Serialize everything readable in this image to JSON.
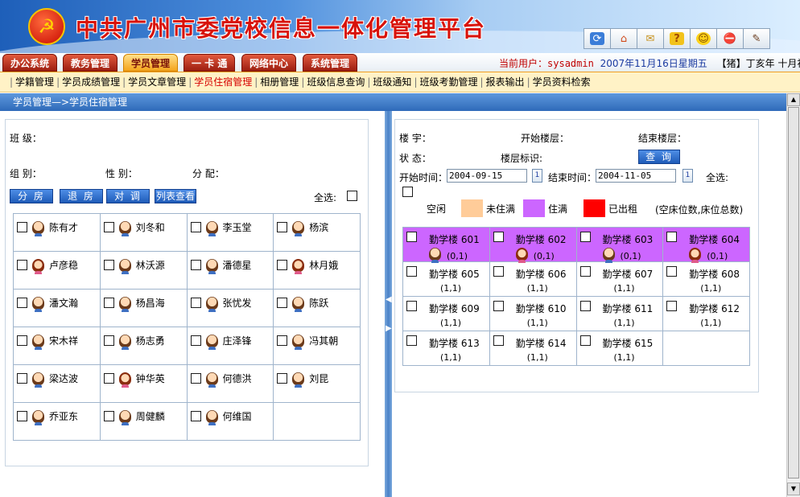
{
  "header": {
    "title": "中共广州市委党校信息一体化管理平台",
    "emblem_glyph": "☭",
    "toolbar_icons": [
      "refresh-icon",
      "home-icon",
      "mail-icon",
      "help-icon",
      "smiley-icon",
      "stop-icon",
      "user-settings-icon"
    ],
    "toolbar_glyphs": [
      "⟳",
      "⌂",
      "✉",
      "?",
      "☺",
      "⛔",
      "✎"
    ]
  },
  "nav": {
    "tabs": [
      "办公系统",
      "教务管理",
      "学员管理",
      "一 卡 通",
      "网络中心",
      "系统管理"
    ],
    "active_tab": "学员管理",
    "user_label": "当前用户：",
    "user": "sysadmin",
    "date": "2007年11月16日星期五",
    "lunar": "【猪】丁亥年 十月初七"
  },
  "subnav": {
    "items": [
      "学籍管理",
      "学员成绩管理",
      "学员文章管理",
      "学员住宿管理",
      "相册管理",
      "班级信息查询",
      "班级通知",
      "班级考勤管理",
      "报表输出",
      "学员资料检索"
    ],
    "active": "学员住宿管理"
  },
  "breadcrumb": "学员管理—>学员住宿管理",
  "left": {
    "class_label": "班 级：",
    "group_label": "组 别：",
    "gender_label": "性 别：",
    "assign_label": "分 配：",
    "buttons": [
      "分 房",
      "退 房",
      "对 调",
      "列表查看"
    ],
    "select_all_label": "全选:",
    "students": [
      {
        "name": "陈有才",
        "gender": "m"
      },
      {
        "name": "刘冬和",
        "gender": "m"
      },
      {
        "name": "李玉堂",
        "gender": "m"
      },
      {
        "name": "杨滨",
        "gender": "m"
      },
      {
        "name": "卢彦稳",
        "gender": "f"
      },
      {
        "name": "林沃源",
        "gender": "m"
      },
      {
        "name": "潘德星",
        "gender": "m"
      },
      {
        "name": "林月娥",
        "gender": "f"
      },
      {
        "name": "潘文瀚",
        "gender": "m"
      },
      {
        "name": "杨昌海",
        "gender": "m"
      },
      {
        "name": "张忧发",
        "gender": "m"
      },
      {
        "name": "陈跃",
        "gender": "m"
      },
      {
        "name": "宋木祥",
        "gender": "m"
      },
      {
        "name": "杨志勇",
        "gender": "m"
      },
      {
        "name": "庄泽锋",
        "gender": "m"
      },
      {
        "name": "冯其朝",
        "gender": "m"
      },
      {
        "name": "梁达波",
        "gender": "m"
      },
      {
        "name": "钟华英",
        "gender": "f"
      },
      {
        "name": "何德洪",
        "gender": "m"
      },
      {
        "name": "刘昆",
        "gender": "m"
      },
      {
        "name": "乔亚东",
        "gender": "m"
      },
      {
        "name": "周健麟",
        "gender": "m"
      },
      {
        "name": "何维国",
        "gender": "m"
      }
    ]
  },
  "right": {
    "building_label": "楼 宇：",
    "start_floor_label": "开始楼层：",
    "end_floor_label": "结束楼层：",
    "status_label": "状 态：",
    "floor_mark_label": "楼层标识:",
    "query_button": "查 询",
    "start_time_label": "开始时间：",
    "start_time": "2004-09-15",
    "end_time_label": "结束时间：",
    "end_time": "2004-11-05",
    "select_all_label": "全选:",
    "calendar_glyph": "1",
    "legend": [
      {
        "label": "空闲",
        "color": "#ffffff"
      },
      {
        "label": "未住满",
        "color": "#ffcc99"
      },
      {
        "label": "住满",
        "color": "#cc66ff"
      },
      {
        "label": "已出租",
        "color": "#ff0000"
      }
    ],
    "legend_note": "(空床位数,床位总数)",
    "rooms": [
      {
        "name": "勤学楼 601",
        "count": "(0,1)",
        "status": "full",
        "occupant": "m"
      },
      {
        "name": "勤学楼 602",
        "count": "(0,1)",
        "status": "full",
        "occupant": "f"
      },
      {
        "name": "勤学楼 603",
        "count": "(0,1)",
        "status": "full",
        "occupant": "m"
      },
      {
        "name": "勤学楼 604",
        "count": "(0,1)",
        "status": "full",
        "occupant": "f"
      },
      {
        "name": "勤学楼 605",
        "count": "(1,1)",
        "status": "free"
      },
      {
        "name": "勤学楼 606",
        "count": "(1,1)",
        "status": "free"
      },
      {
        "name": "勤学楼 607",
        "count": "(1,1)",
        "status": "free"
      },
      {
        "name": "勤学楼 608",
        "count": "(1,1)",
        "status": "free"
      },
      {
        "name": "勤学楼 609",
        "count": "(1,1)",
        "status": "free"
      },
      {
        "name": "勤学楼 610",
        "count": "(1,1)",
        "status": "free"
      },
      {
        "name": "勤学楼 611",
        "count": "(1,1)",
        "status": "free"
      },
      {
        "name": "勤学楼 612",
        "count": "(1,1)",
        "status": "free"
      },
      {
        "name": "勤学楼 613",
        "count": "(1,1)",
        "status": "free"
      },
      {
        "name": "勤学楼 614",
        "count": "(1,1)",
        "status": "free"
      },
      {
        "name": "勤学楼 615",
        "count": "(1,1)",
        "status": "free"
      }
    ]
  }
}
